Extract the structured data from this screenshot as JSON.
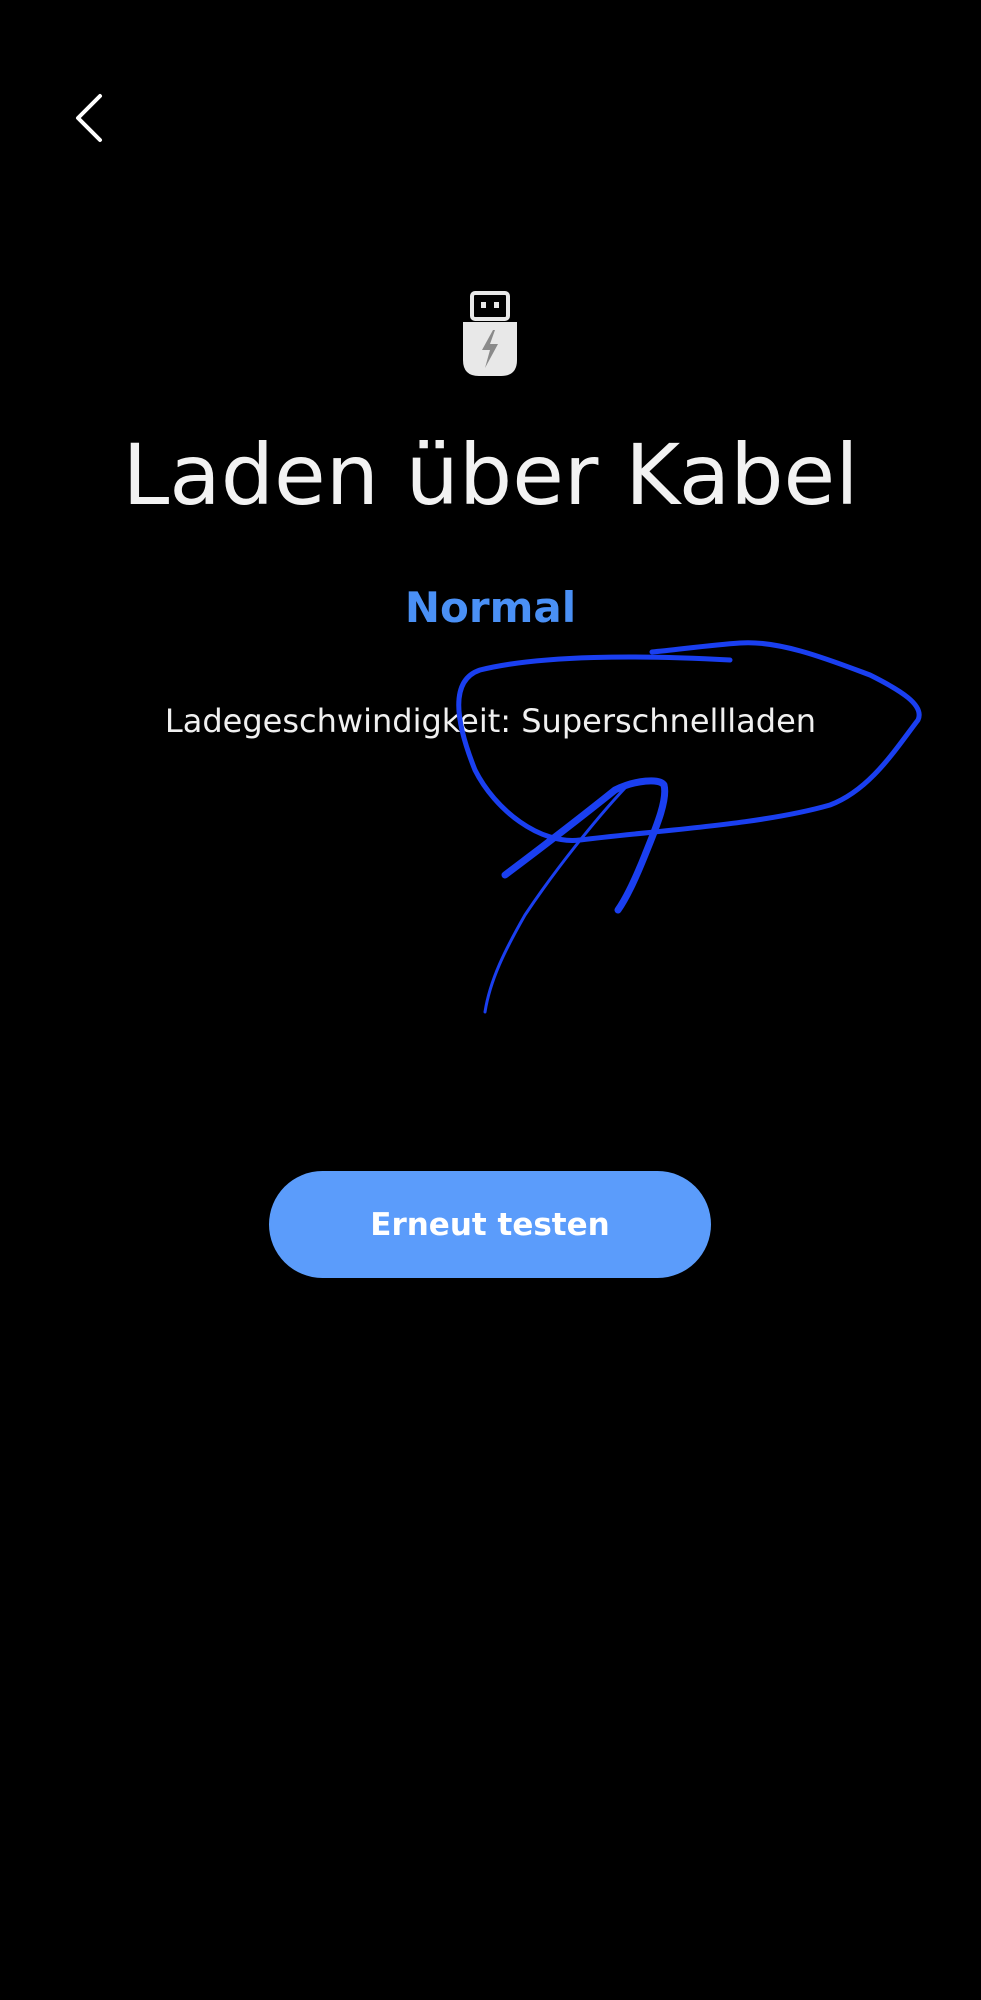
{
  "header": {
    "back_icon": "chevron-left-icon"
  },
  "hero": {
    "icon": "usb-charging-icon",
    "title": "Laden über Kabel"
  },
  "result": {
    "status": "Normal",
    "speed_text": "Ladegeschwindigkeit: Superschnellladen"
  },
  "actions": {
    "retest_label": "Erneut testen"
  },
  "colors": {
    "background": "#000000",
    "accent": "#4a90f5",
    "button": "#5b9cfb",
    "annotation_ink": "#1a3ff0"
  }
}
